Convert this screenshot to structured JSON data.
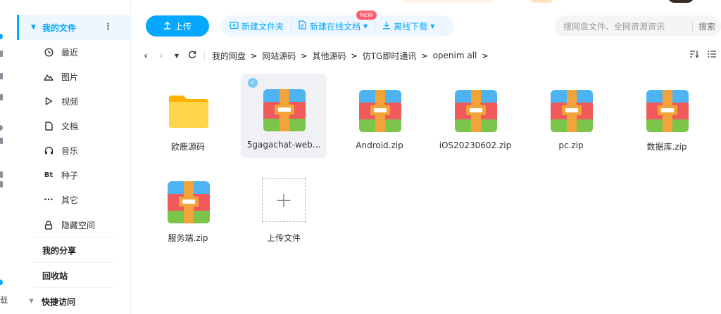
{
  "rail": {
    "text_bottom": "载"
  },
  "sidebar": {
    "my_files": "我的文件",
    "items": [
      {
        "label": "最近",
        "icon": "clock-icon"
      },
      {
        "label": "图片",
        "icon": "image-icon"
      },
      {
        "label": "视频",
        "icon": "play-icon"
      },
      {
        "label": "文档",
        "icon": "document-icon"
      },
      {
        "label": "音乐",
        "icon": "headphones-icon"
      },
      {
        "label": "种子",
        "icon": "bt-icon",
        "glyph": "Bt"
      },
      {
        "label": "其它",
        "icon": "more-icon",
        "glyph": "···"
      },
      {
        "label": "隐藏空间",
        "icon": "lock-icon"
      }
    ],
    "my_share": "我的分享",
    "recycle": "回收站",
    "quick_access": "快捷访问"
  },
  "toolbar": {
    "upload": "上传",
    "new_folder": "新建文件夹",
    "new_online_doc": "新建在线文档",
    "new_badge": "NEW",
    "offline_download": "离线下载"
  },
  "search": {
    "placeholder": "搜网盘文件、全网资源资讯",
    "button": "搜索"
  },
  "breadcrumb": [
    "我的网盘",
    "网站源码",
    "其他源码",
    "仿TG即时通讯",
    "openim all"
  ],
  "files": [
    {
      "name": "欧鹿源码",
      "type": "folder",
      "selected": false
    },
    {
      "name": "5gagachat-web...",
      "type": "zip",
      "selected": true
    },
    {
      "name": "Android.zip",
      "type": "zip",
      "selected": false
    },
    {
      "name": "iOS20230602.zip",
      "type": "zip",
      "selected": false
    },
    {
      "name": "pc.zip",
      "type": "zip",
      "selected": false
    },
    {
      "name": "数据库.zip",
      "type": "zip",
      "selected": false
    },
    {
      "name": "服务端.zip",
      "type": "zip",
      "selected": false
    }
  ],
  "upload_tile": {
    "label": "上传文件"
  },
  "colors": {
    "accent": "#06a7ff",
    "folder": "#ffc21a",
    "zip_top": "#4db3f2",
    "zip_mid": "#f05a5a",
    "zip_bottom": "#7bc64a",
    "zip_strap": "#f2a43a"
  }
}
